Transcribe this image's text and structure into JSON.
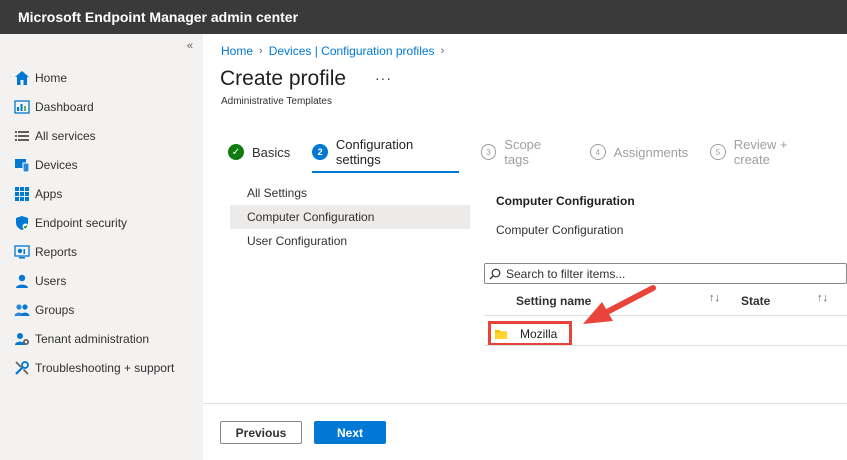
{
  "app": {
    "title": "Microsoft Endpoint Manager admin center"
  },
  "sidebar": {
    "collapse_glyph": "«",
    "items": [
      {
        "label": "Home",
        "icon": "home-icon"
      },
      {
        "label": "Dashboard",
        "icon": "dashboard-icon"
      },
      {
        "label": "All services",
        "icon": "list-icon"
      },
      {
        "label": "Devices",
        "icon": "devices-icon"
      },
      {
        "label": "Apps",
        "icon": "apps-icon"
      },
      {
        "label": "Endpoint security",
        "icon": "shield-icon"
      },
      {
        "label": "Reports",
        "icon": "reports-icon"
      },
      {
        "label": "Users",
        "icon": "user-icon"
      },
      {
        "label": "Groups",
        "icon": "groups-icon"
      },
      {
        "label": "Tenant administration",
        "icon": "tenant-icon"
      },
      {
        "label": "Troubleshooting + support",
        "icon": "wrench-icon"
      }
    ]
  },
  "breadcrumb": {
    "home": "Home",
    "devices": "Devices | Configuration profiles",
    "sep": "›"
  },
  "page": {
    "title": "Create profile",
    "more": "···",
    "subtitle": "Administrative Templates"
  },
  "wizard": {
    "steps": [
      {
        "num": "✓",
        "label": "Basics",
        "state": "done"
      },
      {
        "num": "2",
        "label": "Configuration settings",
        "state": "active"
      },
      {
        "num": "3",
        "label": "Scope tags",
        "state": "pending"
      },
      {
        "num": "4",
        "label": "Assignments",
        "state": "pending"
      },
      {
        "num": "5",
        "label": "Review + create",
        "state": "pending"
      }
    ]
  },
  "tree": {
    "items": [
      "All Settings",
      "Computer Configuration",
      "User Configuration"
    ],
    "selected": "Computer Configuration"
  },
  "content": {
    "heading": "Computer Configuration",
    "subheading": "Computer Configuration"
  },
  "search": {
    "placeholder": "Search to filter items..."
  },
  "table": {
    "columns": [
      "Setting name",
      "State"
    ],
    "sort_glyph": "↑↓",
    "rows": [
      {
        "name": "Mozilla",
        "icon": "folder-icon"
      }
    ]
  },
  "footer": {
    "previous": "Previous",
    "next": "Next"
  },
  "colors": {
    "accent": "#0078d4",
    "success": "#107c10",
    "highlight": "#e8443a",
    "topbar": "#3a3a3a"
  }
}
